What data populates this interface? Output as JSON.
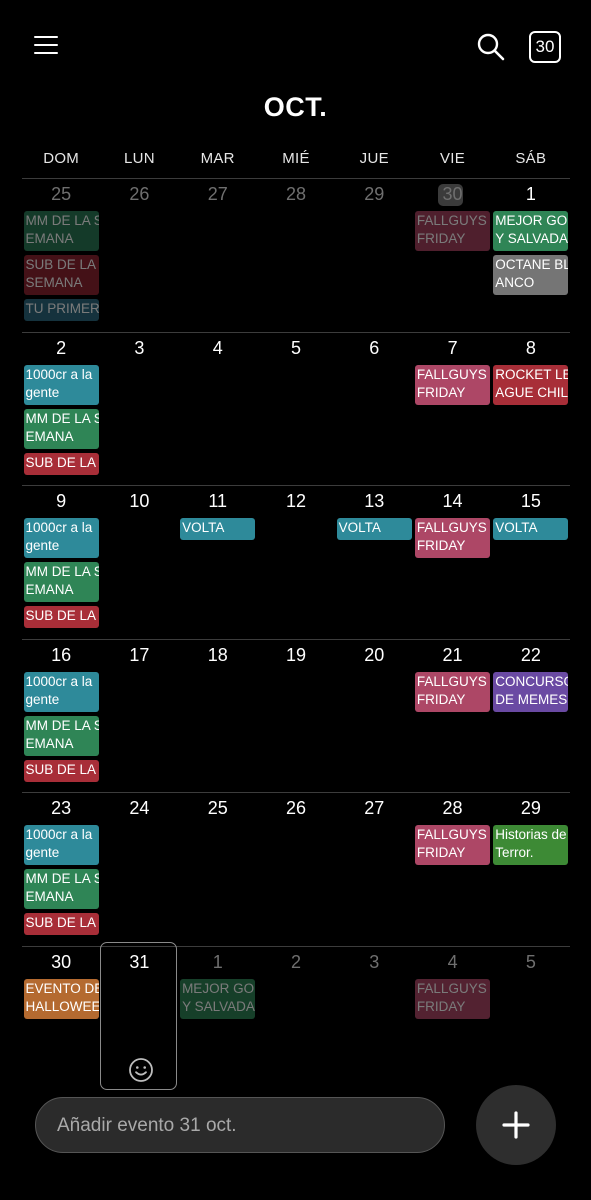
{
  "header": {
    "menu_icon": "hamburger-menu-icon",
    "search_icon": "search-icon",
    "today_button_label": "30",
    "month_title": "OCT."
  },
  "weekdays": [
    "DOM",
    "LUN",
    "MAR",
    "MIÉ",
    "JUE",
    "VIE",
    "SÁB"
  ],
  "today": "30",
  "selected_day": "31",
  "selected_day_icon": "smiley-face-icon",
  "weeks": [
    {
      "days": [
        {
          "num": "25",
          "dim": true
        },
        {
          "num": "26",
          "dim": true
        },
        {
          "num": "27",
          "dim": true
        },
        {
          "num": "28",
          "dim": true
        },
        {
          "num": "29",
          "dim": true
        },
        {
          "num": "30",
          "dim": true,
          "today": true
        },
        {
          "num": "1",
          "dim": false
        }
      ],
      "events": [
        {
          "day": 0,
          "label": "MM DE LA S\nEMANA",
          "color": "#2b7a56",
          "lines": 2,
          "dim": true
        },
        {
          "day": 0,
          "label": "SUB DE LA\nSEMANA",
          "color": "#8e2530",
          "lines": 2,
          "dim": true
        },
        {
          "day": 0,
          "label": "TU PRIMER F",
          "color": "#2c6a80",
          "lines": 1,
          "dim": true
        },
        {
          "day": 5,
          "label": "FALLGUYS\nFRIDAY",
          "color": "#a6425f",
          "lines": 2,
          "dim": true
        },
        {
          "day": 6,
          "label": "MEJOR GOL\nY SALVADA",
          "color": "#2f8556",
          "lines": 2,
          "dim": false
        },
        {
          "day": 6,
          "label": "OCTANE BL\nANCO",
          "color": "#757575",
          "lines": 2,
          "dim": false
        }
      ]
    },
    {
      "days": [
        {
          "num": "2"
        },
        {
          "num": "3"
        },
        {
          "num": "4"
        },
        {
          "num": "5"
        },
        {
          "num": "6"
        },
        {
          "num": "7"
        },
        {
          "num": "8"
        }
      ],
      "events": [
        {
          "day": 0,
          "label": "1000cr a la\ngente",
          "color": "#2e8a9a",
          "lines": 2
        },
        {
          "day": 0,
          "label": "MM DE LA S\nEMANA",
          "color": "#2f8556",
          "lines": 2
        },
        {
          "day": 0,
          "label": "SUB DE LA S",
          "color": "#a82e38",
          "lines": 1
        },
        {
          "day": 5,
          "label": "FALLGUYS\nFRIDAY",
          "color": "#ad4766",
          "lines": 2
        },
        {
          "day": 6,
          "label": "ROCKET LE\nAGUE CHILE",
          "color": "#a82e38",
          "lines": 2
        }
      ]
    },
    {
      "days": [
        {
          "num": "9"
        },
        {
          "num": "10"
        },
        {
          "num": "11"
        },
        {
          "num": "12"
        },
        {
          "num": "13"
        },
        {
          "num": "14"
        },
        {
          "num": "15"
        }
      ],
      "events": [
        {
          "day": 0,
          "label": "1000cr a la\ngente",
          "color": "#2e8a9a",
          "lines": 2
        },
        {
          "day": 0,
          "label": "MM DE LA S\nEMANA",
          "color": "#2f8556",
          "lines": 2
        },
        {
          "day": 0,
          "label": "SUB DE LA S",
          "color": "#a82e38",
          "lines": 1
        },
        {
          "day": 2,
          "label": "VOLTA",
          "color": "#2e8a9a",
          "lines": 1
        },
        {
          "day": 4,
          "label": "VOLTA",
          "color": "#2e8a9a",
          "lines": 1
        },
        {
          "day": 5,
          "label": "FALLGUYS\nFRIDAY",
          "color": "#ad4766",
          "lines": 2
        },
        {
          "day": 6,
          "label": "VOLTA",
          "color": "#2e8a9a",
          "lines": 1
        }
      ]
    },
    {
      "days": [
        {
          "num": "16"
        },
        {
          "num": "17"
        },
        {
          "num": "18"
        },
        {
          "num": "19"
        },
        {
          "num": "20"
        },
        {
          "num": "21"
        },
        {
          "num": "22"
        }
      ],
      "events": [
        {
          "day": 0,
          "label": "1000cr a la\ngente",
          "color": "#2e8a9a",
          "lines": 2
        },
        {
          "day": 0,
          "label": "MM DE LA S\nEMANA",
          "color": "#2f8556",
          "lines": 2
        },
        {
          "day": 0,
          "label": "SUB DE LA S",
          "color": "#a82e38",
          "lines": 1
        },
        {
          "day": 5,
          "label": "FALLGUYS\nFRIDAY",
          "color": "#ad4766",
          "lines": 2
        },
        {
          "day": 6,
          "label": "CONCURSO\nDE MEMES",
          "color": "#6a4aa3",
          "lines": 2
        }
      ]
    },
    {
      "days": [
        {
          "num": "23"
        },
        {
          "num": "24"
        },
        {
          "num": "25"
        },
        {
          "num": "26"
        },
        {
          "num": "27"
        },
        {
          "num": "28"
        },
        {
          "num": "29"
        }
      ],
      "events": [
        {
          "day": 0,
          "label": "1000cr a la\ngente",
          "color": "#2e8a9a",
          "lines": 2
        },
        {
          "day": 0,
          "label": "MM DE LA S\nEMANA",
          "color": "#2f8556",
          "lines": 2
        },
        {
          "day": 0,
          "label": "SUB DE LA S",
          "color": "#a82e38",
          "lines": 1
        },
        {
          "day": 5,
          "label": "FALLGUYS\nFRIDAY",
          "color": "#ad4766",
          "lines": 2
        },
        {
          "day": 6,
          "label": "Historias de\nTerror.",
          "color": "#3d8a35",
          "lines": 2
        }
      ]
    },
    {
      "days": [
        {
          "num": "30"
        },
        {
          "num": "31",
          "selected": true
        },
        {
          "num": "1",
          "dim": true
        },
        {
          "num": "2",
          "dim": true
        },
        {
          "num": "3",
          "dim": true
        },
        {
          "num": "4",
          "dim": true
        },
        {
          "num": "5",
          "dim": true
        }
      ],
      "events": [
        {
          "day": 0,
          "label": "EVENTO DE\nHALLOWEEN",
          "color": "#b46a30",
          "lines": 2
        },
        {
          "day": 2,
          "label": "MEJOR GOL\nY SALVADA",
          "color": "#2f8556",
          "lines": 2,
          "dim": true
        },
        {
          "day": 5,
          "label": "FALLGUYS\nFRIDAY",
          "color": "#ad4766",
          "lines": 2,
          "dim": true
        }
      ]
    }
  ],
  "add_event": {
    "placeholder": "Añadir evento 31 oct.",
    "fab_icon": "plus-icon"
  }
}
